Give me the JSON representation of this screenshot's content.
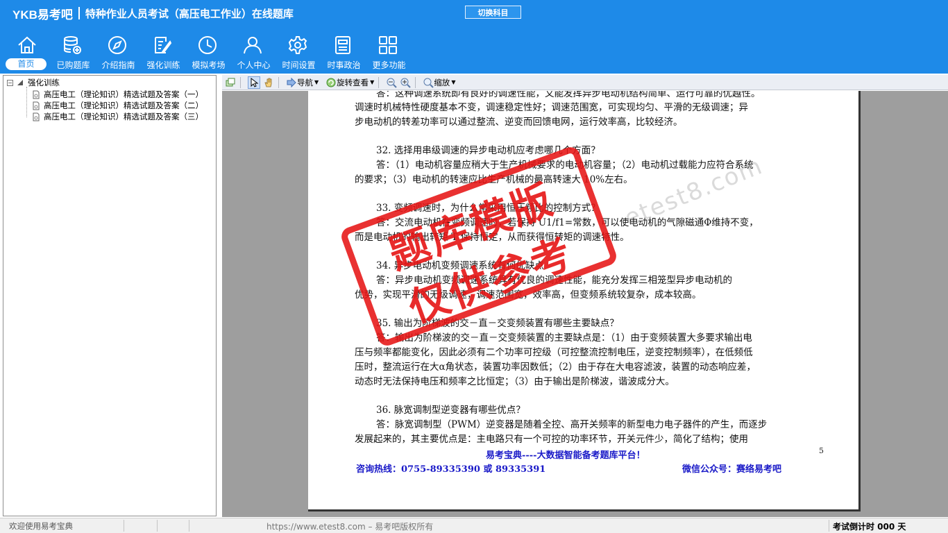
{
  "header": {
    "logo": "YKB易考吧",
    "title": "特种作业人员考试（高压电工作业）在线题库",
    "switch_button": "切换科目"
  },
  "nav": [
    {
      "label": "首页",
      "icon": "home-icon"
    },
    {
      "label": "已购题库",
      "icon": "database-icon"
    },
    {
      "label": "介绍指南",
      "icon": "compass-icon"
    },
    {
      "label": "强化训练",
      "icon": "edit-icon"
    },
    {
      "label": "模拟考场",
      "icon": "clock-icon"
    },
    {
      "label": "个人中心",
      "icon": "user-icon"
    },
    {
      "label": "时间设置",
      "icon": "gear-icon"
    },
    {
      "label": "时事政治",
      "icon": "news-icon"
    },
    {
      "label": "更多功能",
      "icon": "grid-icon"
    }
  ],
  "tree": {
    "root": "强化训练",
    "children": [
      "高压电工（理论知识）精选试题及答案（一）",
      "高压电工（理论知识）精选试题及答案（二）",
      "高压电工（理论知识）精选试题及答案（三）"
    ]
  },
  "toolbar": {
    "navigate": "导航",
    "rotate": "旋转查看",
    "zoom": "缩放"
  },
  "document": {
    "lines": [
      "答：这种调速系统即有良好的调速性能，又能发挥异步电动机结构简单、运行可靠的优越性。",
      "调速时机械特性硬度基本不变，调速稳定性好；调速范围宽，可实现均匀、平滑的无级调速；异",
      "步电动机的转差功率可以通过整流、逆变而回馈电网，运行效率高，比较经济。",
      "32. 选择用串级调速的异步电动机应考虑哪几个方面？",
      "答：（1）电动机容量应稍大于生产机械要求的电动机容量；（2）电动机过载能力应符合系统",
      "的要求；（3）电动机的转速应比生产机械的最高转速大 10%左右。",
      "33. 变频调速时，为什么常采用恒压频比的控制方式？",
      "答：交流电动机在变频调速时，若保持 U1/f1=常数，可以使电动机的气隙磁通Φ维持不变，",
      "而是电动机的输出转矩 T 保持恒定，从而获得恒转矩的调速特性。",
      "34. 异步电动机变频调速系统有何优缺点",
      "答：异步电动机变频调速系统具有优良的调速性能，能充分发挥三相笼型异步电动机的",
      "优势，实现平滑的无级调速，调速范围宽，效率高，但变频系统较复杂，成本较高。",
      "35. 输出为阶梯波的交－直－交变频装置有哪些主要缺点？",
      "答：输出为阶梯波的交－直－交变频装置的主要缺点是：（1）由于变频装置大多要求输出电",
      "压与频率都能变化，因此必须有二个功率可控级（可控整流控制电压，逆变控制频率），在低频低",
      "压时，整流运行在大α角状态，装置功率因数低；（2）由于存在大电容滤波，装置的动态响应差，",
      "动态时无法保持电压和频率之比恒定；（3）由于输出是阶梯波，谐波成分大。",
      "36. 脉宽调制型逆变器有哪些优点？",
      "答：脉宽调制型（PWM）逆变器是随着全控、高开关频率的新型电力电子器件的产生，而逐步",
      "发展起来的，其主要优点是：主电路只有一个可控的功率环节，开关元件少，简化了结构；使用"
    ],
    "footer_title": "易考宝典----大数据智能备考题库平台！",
    "page_number": "5",
    "hotline": "咨询热线：0755-89335390 或 89335391",
    "wechat": "微信公众号：赛络易考吧",
    "watermark_url": "etest8.com",
    "stamp_line1": "题库模版",
    "stamp_line2": "仅供参考"
  },
  "status": {
    "left": "欢迎使用易考宝典",
    "center": "https://www.etest8.com – 易考吧版权所有",
    "right": "考试倒计时 000 天"
  }
}
